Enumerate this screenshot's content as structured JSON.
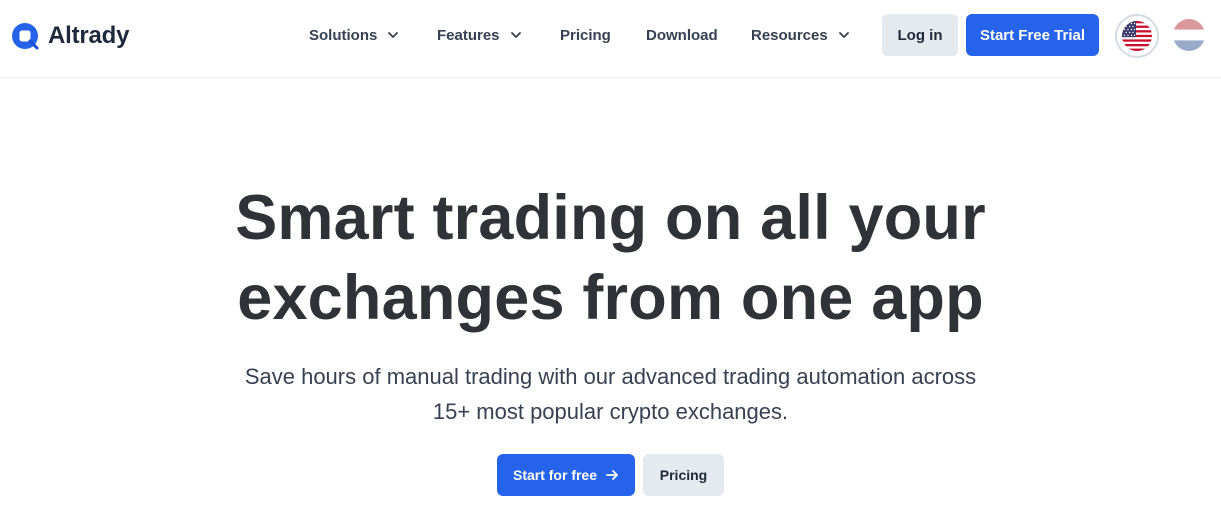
{
  "header": {
    "logo_text": "Altrady",
    "nav": [
      {
        "label": "Solutions",
        "has_dropdown": true
      },
      {
        "label": "Features",
        "has_dropdown": true
      },
      {
        "label": "Pricing",
        "has_dropdown": false
      },
      {
        "label": "Download",
        "has_dropdown": false
      },
      {
        "label": "Resources",
        "has_dropdown": true
      }
    ],
    "login_label": "Log in",
    "trial_label": "Start Free Trial",
    "languages": [
      {
        "icon": "us-flag-icon",
        "selected": true
      },
      {
        "icon": "nl-flag-icon",
        "selected": false
      }
    ]
  },
  "hero": {
    "title_line1": "Smart trading on all your",
    "title_line2": "exchanges from one app",
    "subtitle_line1": "Save hours of manual trading with our advanced trading automation across",
    "subtitle_line2": "15+ most popular crypto exchanges.",
    "primary_cta": "Start for free",
    "secondary_cta": "Pricing"
  },
  "colors": {
    "primary": "#2563eb",
    "secondary_button": "#e5e9f0",
    "heading_text": "#2f3237",
    "body_text": "#374151"
  }
}
